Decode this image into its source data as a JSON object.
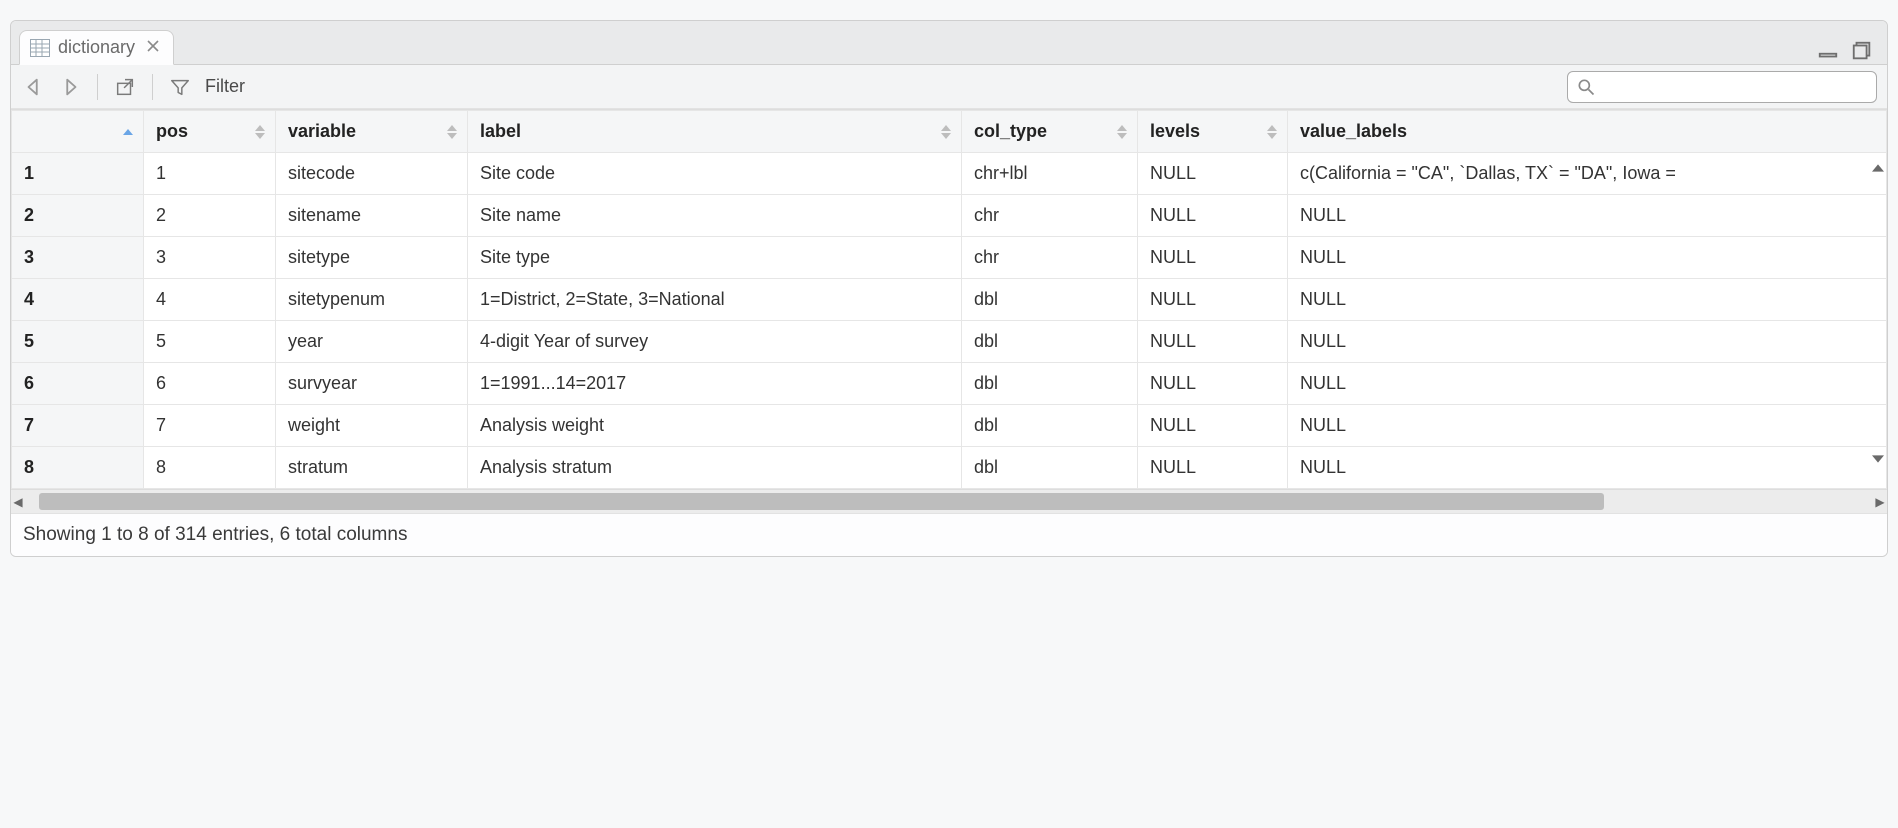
{
  "tab": {
    "title": "dictionary"
  },
  "toolbar": {
    "filter_label": "Filter"
  },
  "search": {
    "placeholder": ""
  },
  "columns": [
    "pos",
    "variable",
    "label",
    "col_type",
    "levels",
    "value_labels"
  ],
  "sorted_asc_col": 0,
  "rows": [
    {
      "n": "1",
      "pos": "1",
      "variable": "sitecode",
      "label": "Site code",
      "col_type": "chr+lbl",
      "levels": "NULL",
      "value_labels": "c(California = \"CA\", `Dallas, TX` = \"DA\", Iowa ="
    },
    {
      "n": "2",
      "pos": "2",
      "variable": "sitename",
      "label": "Site name",
      "col_type": "chr",
      "levels": "NULL",
      "value_labels": "NULL"
    },
    {
      "n": "3",
      "pos": "3",
      "variable": "sitetype",
      "label": "Site type",
      "col_type": "chr",
      "levels": "NULL",
      "value_labels": "NULL"
    },
    {
      "n": "4",
      "pos": "4",
      "variable": "sitetypenum",
      "label": "1=District, 2=State, 3=National",
      "col_type": "dbl",
      "levels": "NULL",
      "value_labels": "NULL"
    },
    {
      "n": "5",
      "pos": "5",
      "variable": "year",
      "label": "4-digit Year of survey",
      "col_type": "dbl",
      "levels": "NULL",
      "value_labels": "NULL"
    },
    {
      "n": "6",
      "pos": "6",
      "variable": "survyear",
      "label": "1=1991...14=2017",
      "col_type": "dbl",
      "levels": "NULL",
      "value_labels": "NULL"
    },
    {
      "n": "7",
      "pos": "7",
      "variable": "weight",
      "label": "Analysis weight",
      "col_type": "dbl",
      "levels": "NULL",
      "value_labels": "NULL"
    },
    {
      "n": "8",
      "pos": "8",
      "variable": "stratum",
      "label": "Analysis stratum",
      "col_type": "dbl",
      "levels": "NULL",
      "value_labels": "NULL"
    }
  ],
  "status": {
    "text": "Showing 1 to 8 of 314 entries, 6 total columns"
  }
}
